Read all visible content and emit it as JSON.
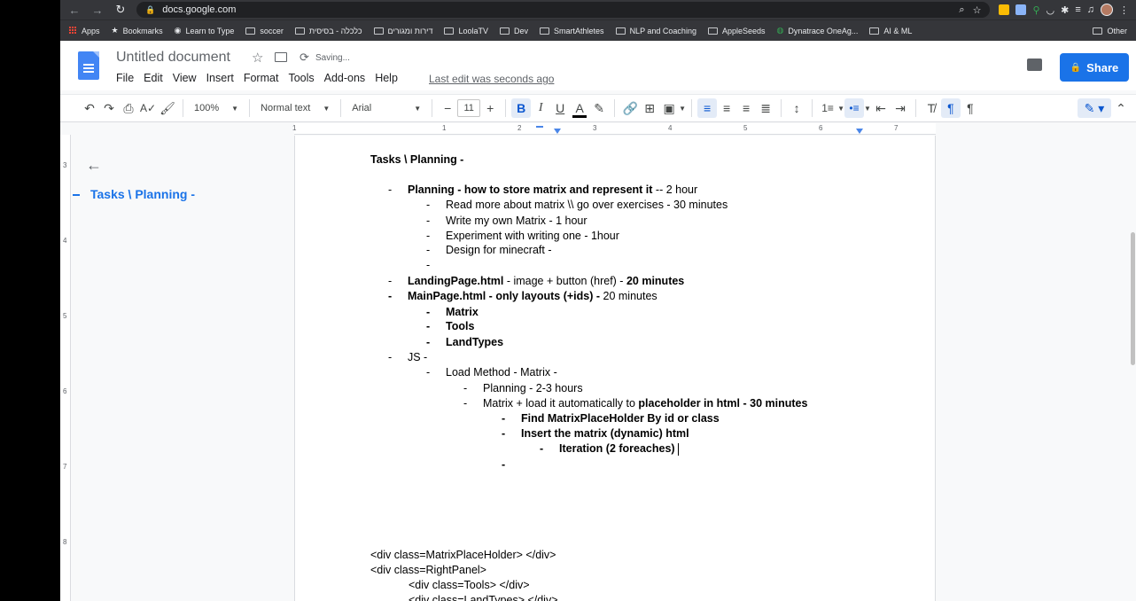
{
  "browser": {
    "url": "docs.google.com",
    "bookmarks": [
      "Apps",
      "Bookmarks",
      "Learn to Type",
      "soccer",
      "כלכלה - בסיסית",
      "דירות ומגורים",
      "LoolaTV",
      "Dev",
      "SmartAthletes",
      "NLP and Coaching",
      "AppleSeeds",
      "Dynatrace OneAg...",
      "AI & ML"
    ],
    "other_bookmarks": "Other"
  },
  "docs": {
    "title": "Untitled document",
    "saving": "Saving...",
    "menu": [
      "File",
      "Edit",
      "View",
      "Insert",
      "Format",
      "Tools",
      "Add-ons",
      "Help"
    ],
    "last_edit": "Last edit was seconds ago",
    "share_label": "Share"
  },
  "toolbar": {
    "zoom": "100%",
    "style": "Normal text",
    "font": "Arial",
    "font_size": "11",
    "minus": "−",
    "plus": "+"
  },
  "ruler": {
    "numbers": [
      "1",
      "1",
      "2",
      "3",
      "4",
      "5",
      "6",
      "7"
    ],
    "vnumbers": [
      "3",
      "4",
      "5",
      "6",
      "7",
      "8"
    ]
  },
  "outline": {
    "heading": "Tasks \\ Planning -"
  },
  "document": {
    "heading": "Tasks \\ Planning -",
    "lines": [
      {
        "bullet": "-",
        "parts": [
          {
            "t": "Planning - how to store matrix and represent it",
            "b": true
          },
          {
            "t": " -- 2 hour",
            "b": false
          }
        ]
      },
      {
        "bullet": "-",
        "parts": [
          {
            "t": "Read more about matrix \\\\ go over exercises - 30 minutes",
            "b": false
          }
        ]
      },
      {
        "bullet": "-",
        "parts": [
          {
            "t": "Write my own Matrix - 1 hour",
            "b": false
          }
        ]
      },
      {
        "bullet": "-",
        "parts": [
          {
            "t": "Experiment with writing one - 1hour",
            "b": false
          }
        ]
      },
      {
        "bullet": "-",
        "parts": [
          {
            "t": "Design for minecraft -",
            "b": false
          }
        ]
      },
      {
        "bullet": "-",
        "parts": []
      },
      {
        "bullet": "-",
        "parts": [
          {
            "t": "LandingPage.html",
            "b": true
          },
          {
            "t": " - image + button (href) - ",
            "b": false
          },
          {
            "t": "20 minutes",
            "b": true
          }
        ]
      },
      {
        "bullet": "-",
        "parts": [
          {
            "t": "MainPage.html - only layouts (+ids) - ",
            "b": true
          },
          {
            "t": "20 minutes",
            "b": false
          }
        ]
      },
      {
        "bullet": "-",
        "parts": [
          {
            "t": "Matrix",
            "b": true
          }
        ]
      },
      {
        "bullet": "-",
        "parts": [
          {
            "t": "Tools",
            "b": true
          }
        ]
      },
      {
        "bullet": "-",
        "parts": [
          {
            "t": "LandTypes",
            "b": true
          }
        ]
      },
      {
        "bullet": "-",
        "parts": [
          {
            "t": "JS -",
            "b": false
          }
        ]
      },
      {
        "bullet": "-",
        "parts": [
          {
            "t": "Load Method - Matrix -",
            "b": false
          }
        ]
      },
      {
        "bullet": "-",
        "parts": [
          {
            "t": "Planning - 2-3 hours",
            "b": false
          }
        ]
      },
      {
        "bullet": "-",
        "parts": [
          {
            "t": "Matrix + load it automatically to ",
            "b": false
          },
          {
            "t": "placeholder in html - 30 minutes",
            "b": true
          }
        ]
      },
      {
        "bullet": "-",
        "parts": [
          {
            "t": "Find MatrixPlaceHolder By id or class",
            "b": true
          }
        ]
      },
      {
        "bullet": "-",
        "parts": [
          {
            "t": "Insert the matrix (dynamic) html",
            "b": true
          }
        ]
      },
      {
        "bullet": "-",
        "parts": [
          {
            "t": "Iteration (2 foreaches)",
            "b": true
          }
        ]
      },
      {
        "bullet": "-",
        "parts": []
      }
    ],
    "code": [
      "<div class=MatrixPlaceHolder> </div>",
      "<div class=RightPanel>",
      "<div class=Tools> </div>",
      "<div class=LandTypes> </div>"
    ]
  }
}
